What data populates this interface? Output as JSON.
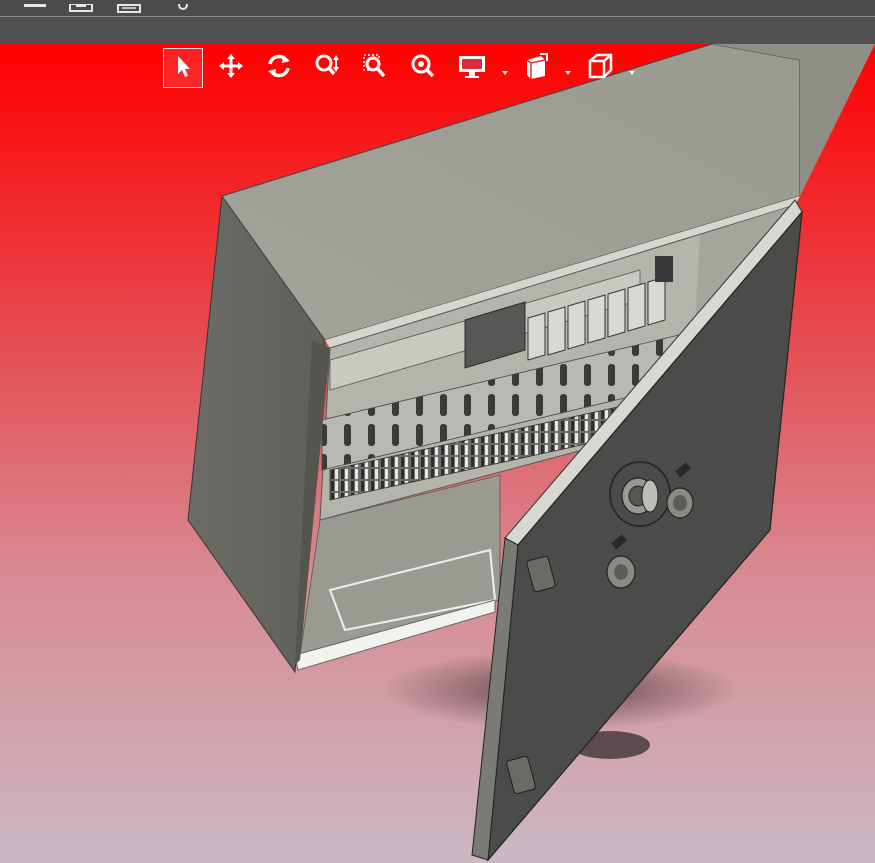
{
  "colors": {
    "viewport_top": "#ff0000",
    "viewport_bottom": "#cbb8c3",
    "toolbar_bg": "#4b4b4b",
    "enclosure_body": "#9c9c94",
    "door": "#4a4a48"
  },
  "menu_bar": {
    "icons": [
      "menu-icon",
      "save-icon",
      "print-icon",
      "options-icon"
    ]
  },
  "heads_up_toolbar": {
    "tools": [
      {
        "name": "select",
        "icon": "arrow-pointer-icon",
        "active": true
      },
      {
        "name": "pan",
        "icon": "move-arrows-icon"
      },
      {
        "name": "rotate",
        "icon": "rotate-icon"
      },
      {
        "name": "zoom-in-out",
        "icon": "zoom-in-out-icon"
      },
      {
        "name": "zoom-to-area",
        "icon": "zoom-area-icon"
      },
      {
        "name": "zoom-to-fit",
        "icon": "zoom-fit-icon"
      },
      {
        "name": "display-style",
        "icon": "monitor-icon",
        "dropdown": true
      },
      {
        "name": "view-orientation",
        "icon": "view-cube-icon",
        "dropdown": true
      },
      {
        "name": "section-view",
        "icon": "box-icon",
        "dropdown": true
      }
    ]
  }
}
